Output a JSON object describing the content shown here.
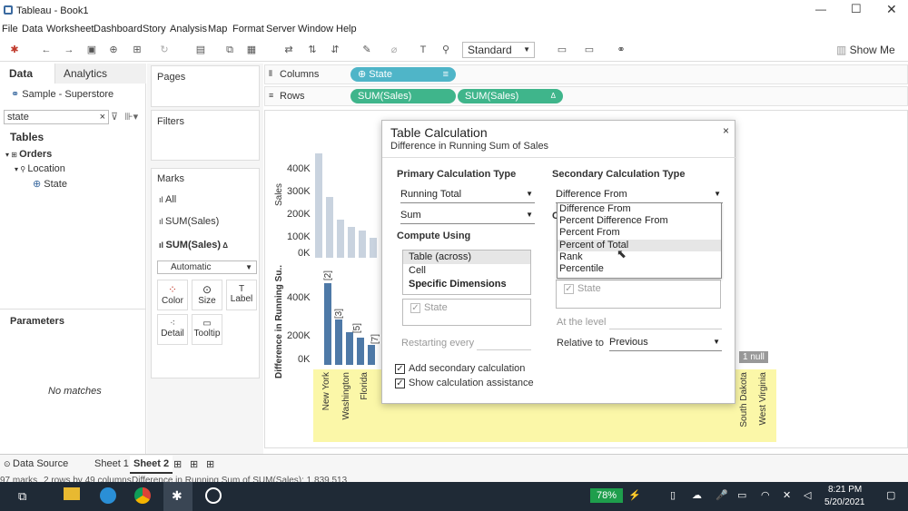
{
  "window": {
    "title": "Tableau - Book1"
  },
  "menu": [
    "File",
    "Data",
    "Worksheet",
    "Dashboard",
    "Story",
    "Analysis",
    "Map",
    "Format",
    "Server",
    "Window",
    "Help"
  ],
  "toolbar": {
    "view_mode": "Standard",
    "show_me": "Show Me"
  },
  "left": {
    "tab_data": "Data",
    "tab_analytics": "Analytics",
    "source": "Sample - Superstore",
    "search_value": "state",
    "tables_title": "Tables",
    "table": "Orders",
    "folder": "Location",
    "field": "State",
    "parameters": "Parameters",
    "no_matches": "No matches"
  },
  "cards": {
    "pages": "Pages",
    "filters": "Filters",
    "marks": "Marks",
    "all": "All",
    "sum_sales": "SUM(Sales)",
    "sum_sales2": "SUM(Sales)",
    "mark_type": "Automatic",
    "color": "Color",
    "size": "Size",
    "label": "Label",
    "detail": "Detail",
    "tooltip": "Tooltip"
  },
  "shelves": {
    "columns": "Columns",
    "rows": "Rows",
    "col_pill": "State",
    "row_pill1": "SUM(Sales)",
    "row_pill2": "SUM(Sales)"
  },
  "chart": {
    "top_axis": "Sales",
    "top_ticks": [
      "400K",
      "300K",
      "200K",
      "100K",
      "0K"
    ],
    "bottom_axis": "Difference in Running Su..",
    "bottom_ticks": [
      "400K",
      "200K",
      "0K"
    ],
    "rank_labels": [
      "[2]",
      "[3]",
      "[5]",
      "[7]"
    ],
    "states": [
      "New York",
      "Washington",
      "Florida",
      "South Dakota",
      "West Virginia"
    ],
    "null_label": "1 null"
  },
  "dialog": {
    "title": "Table Calculation",
    "subtitle": "Difference in Running Sum of Sales",
    "primary_label": "Primary Calculation Type",
    "primary_value": "Running Total",
    "aggregation": "Sum",
    "compute_label": "Compute Using",
    "compute_items": [
      "Table (across)",
      "Cell",
      "Specific Dimensions"
    ],
    "dim_state": "State",
    "restarting": "Restarting every",
    "secondary_label": "Secondary Calculation Type",
    "secondary_value": "Difference From",
    "secondary_options": [
      "Difference From",
      "Percent Difference From",
      "Percent From",
      "Percent of Total",
      "Rank",
      "Percentile"
    ],
    "sec_state": "State",
    "at_level": "At the level",
    "relative_to": "Relative to",
    "relative_value": "Previous",
    "add_secondary": "Add secondary calculation",
    "show_assist": "Show calculation assistance"
  },
  "status": {
    "data_source": "Data Source",
    "sheet1": "Sheet 1",
    "sheet2": "Sheet 2",
    "marks_info": "97 marks",
    "rows_info": "2 rows by 49 columns",
    "sum_info": "Difference in Running Sum of SUM(Sales): 1,839,513"
  },
  "taskbar": {
    "battery": "78%",
    "time": "8:21 PM",
    "date": "5/20/2021"
  }
}
